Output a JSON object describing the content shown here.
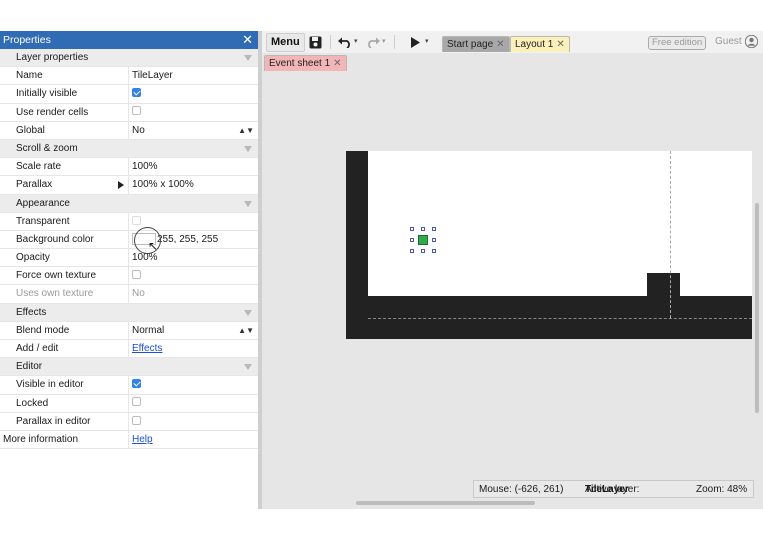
{
  "properties": {
    "title": "Properties",
    "close_glyph": "✕",
    "rows": {
      "section_layer": "Layer properties",
      "name_label": "Name",
      "name_value": "TileLayer",
      "initially_visible_label": "Initially visible",
      "initially_visible": true,
      "use_render_cells_label": "Use render cells",
      "use_render_cells": false,
      "global_label": "Global",
      "global_value": "No",
      "section_scroll": "Scroll & zoom",
      "scale_rate_label": "Scale rate",
      "scale_rate_value": "100%",
      "parallax_label": "Parallax",
      "parallax_value": "100% x 100%",
      "section_appearance": "Appearance",
      "transparent_label": "Transparent",
      "transparent": false,
      "background_color_label": "Background color",
      "background_color_value": "255, 255, 255",
      "opacity_label": "Opacity",
      "opacity_value": "100%",
      "force_own_texture_label": "Force own texture",
      "force_own_texture": false,
      "uses_own_texture_label": "Uses own texture",
      "uses_own_texture_value": "No",
      "section_effects": "Effects",
      "blend_mode_label": "Blend mode",
      "blend_mode_value": "Normal",
      "add_edit_label": "Add / edit",
      "add_edit_link": "Effects",
      "section_editor": "Editor",
      "visible_in_editor_label": "Visible in editor",
      "visible_in_editor": true,
      "locked_label": "Locked",
      "locked": false,
      "parallax_in_editor_label": "Parallax in editor",
      "parallax_in_editor": false,
      "more_info_label": "More information",
      "more_info_link": "Help"
    }
  },
  "toolbar": {
    "menu_label": "Menu",
    "icons": [
      "save-icon",
      "undo-icon",
      "redo-icon",
      "play-icon"
    ],
    "tabs": [
      {
        "label": "Start page",
        "active": false
      },
      {
        "label": "Layout 1",
        "active": true
      }
    ],
    "event_tab_label": "Event sheet 1",
    "tab_close": "✕",
    "edition_badge": "Free edition",
    "user_label": "Guest"
  },
  "status": {
    "mouse": "Mouse: (-626, 261)",
    "active_layer_prefix": "Active layer: ",
    "active_layer": "TileLayer",
    "zoom": "Zoom: 48%"
  },
  "colors": {
    "accent": "#2f6cb3",
    "checkbox": "#2f84e8",
    "layout_tab": "#fbf0b9",
    "event_tab": "#f2b6b6",
    "sprite": "#2faa4a"
  }
}
